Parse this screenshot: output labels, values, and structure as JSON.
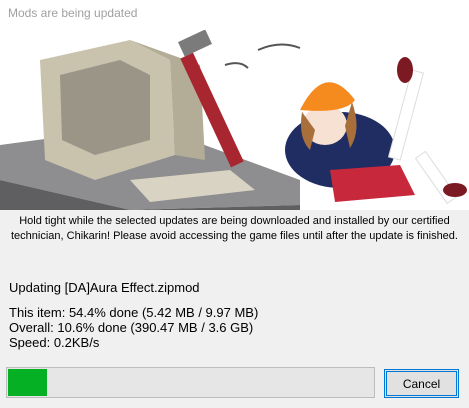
{
  "window": {
    "title": "Mods are being updated"
  },
  "notice": {
    "line1": "Hold tight while the selected updates are being downloaded and installed by our certified",
    "line2": "technician, Chikarin! Please avoid accessing the game files until after the update is finished."
  },
  "status": {
    "updating": "Updating [DA]Aura Effect.zipmod",
    "this_item": "This item: 54.4% done (5.42 MB / 9.97 MB)",
    "overall": "Overall: 10.6% done (390.47 MB / 3.6 GB)",
    "speed": "Speed: 0.2KB/s"
  },
  "progress": {
    "fraction": 0.106,
    "fill_color": "#06b025"
  },
  "buttons": {
    "cancel": "Cancel"
  }
}
